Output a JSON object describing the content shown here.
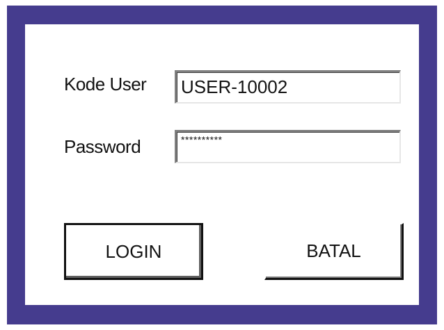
{
  "form": {
    "user_label": "Kode User",
    "user_value": "USER-10002",
    "password_label": "Password",
    "password_value": "**********",
    "login_label": "LOGIN",
    "cancel_label": "BATAL"
  },
  "colors": {
    "frame": "#453c8e",
    "panel": "#ffffff"
  }
}
